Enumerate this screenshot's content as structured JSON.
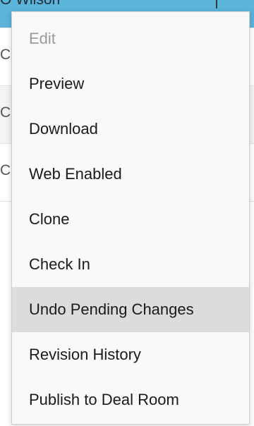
{
  "background_list": {
    "selected_row_text": "O Wilson",
    "rows": [
      {
        "text": "C"
      },
      {
        "text": "C"
      },
      {
        "text": "C"
      }
    ]
  },
  "context_menu": {
    "items": [
      {
        "label": "Edit",
        "state": "disabled"
      },
      {
        "label": "Preview",
        "state": "normal"
      },
      {
        "label": "Download",
        "state": "normal"
      },
      {
        "label": "Web Enabled",
        "state": "normal"
      },
      {
        "label": "Clone",
        "state": "normal"
      },
      {
        "label": "Check In",
        "state": "normal"
      },
      {
        "label": "Undo Pending Changes",
        "state": "hovered"
      },
      {
        "label": "Revision History",
        "state": "normal"
      },
      {
        "label": "Publish to Deal Room",
        "state": "normal"
      }
    ]
  },
  "colors": {
    "selected_row": "#5bb4da",
    "menu_background": "#f9f9f9",
    "menu_hover": "#dcdcdc",
    "disabled_text": "#9a9a9a"
  }
}
